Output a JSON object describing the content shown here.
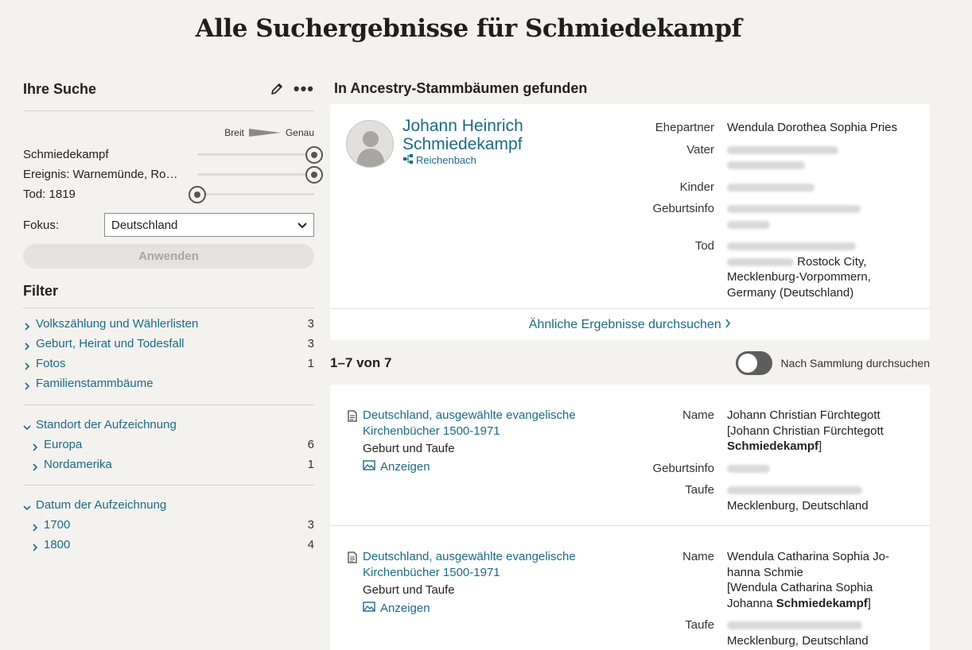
{
  "page": {
    "title": "Alle Suchergebnisse für Schmiedekampf"
  },
  "search": {
    "heading": "Ihre Suche",
    "scale_left": "Breit",
    "scale_right": "Genau",
    "criteria": [
      {
        "label": "Schmiedekampf",
        "level": 1.0
      },
      {
        "label": "Ereignis: Warnemünde, Rost...",
        "level": 1.0
      },
      {
        "label": "Tod: 1819",
        "level": 0.0
      }
    ],
    "focus_label": "Fokus:",
    "focus_value": "Deutschland",
    "apply_label": "Anwenden"
  },
  "filter": {
    "heading": "Filter",
    "categories": [
      {
        "label": "Volkszählung und Wählerlisten",
        "count": "3"
      },
      {
        "label": "Geburt, Heirat und Todesfall",
        "count": "3"
      },
      {
        "label": "Fotos",
        "count": "1"
      },
      {
        "label": "Familienstammbäume",
        "count": ""
      }
    ],
    "location": {
      "label": "Standort der Aufzeichnung",
      "items": [
        {
          "label": "Europa",
          "count": "6"
        },
        {
          "label": "Nordamerika",
          "count": "1"
        }
      ]
    },
    "date": {
      "label": "Datum der Aufzeichnung",
      "items": [
        {
          "label": "1700",
          "count": "3"
        },
        {
          "label": "1800",
          "count": "4"
        }
      ]
    }
  },
  "tree": {
    "heading": "In Ancestry-Stammbäumen gefunden",
    "name_line1": "Johann Heinrich",
    "name_line2": "Schmiedekampf",
    "tree_name": "Reichenbach",
    "facts": {
      "spouse_label": "Ehepartner",
      "spouse_value": "Wendula Dorothea Sophia Pries",
      "father_label": "Vater",
      "children_label": "Kinder",
      "birth_label": "Geburtsinfo",
      "death_label": "Tod",
      "death_place": "Rostock City,",
      "death_place2": "Mecklenburg-Vorpommern, Germany (Deutschland)"
    },
    "similar_label": "Ähnliche Ergebnisse durchsuchen"
  },
  "results": {
    "count_label": "1–7 von 7",
    "toggle_label": "Nach Sammlung durchsuchen",
    "records": [
      {
        "title": "Deutschland, ausgewählte evangelische Kirchenbücher 1500-1971",
        "subtitle": "Geburt und Taufe",
        "view_label": "Anzeigen",
        "name_label": "Name",
        "name_value": "Johann Christian Fürchtegott",
        "alt_prefix": "[Johann Christian Fürchtegott",
        "alt_bold": "Schmiedekampf",
        "alt_suffix": "]",
        "birth_label": "Geburtsinfo",
        "baptism_label": "Taufe",
        "baptism_place": "Mecklenburg, Deutschland"
      },
      {
        "title": "Deutschland, ausgewählte evangelische Kirchenbücher 1500-1971",
        "subtitle": "Geburt und Taufe",
        "view_label": "Anzeigen",
        "name_label": "Name",
        "name_value": "Wendula Catharina Sophia Jo-hanna Schmie",
        "alt_prefix": "[Wendula Catharina Sophia Johanna",
        "alt_bold": "Schmiedekampf",
        "alt_suffix": "]",
        "baptism_label": "Taufe",
        "baptism_place": "Mecklenburg, Deutschland"
      }
    ]
  },
  "colors": {
    "link": "#1d6a84",
    "background": "#f4f2ef",
    "card": "#ffffff"
  }
}
